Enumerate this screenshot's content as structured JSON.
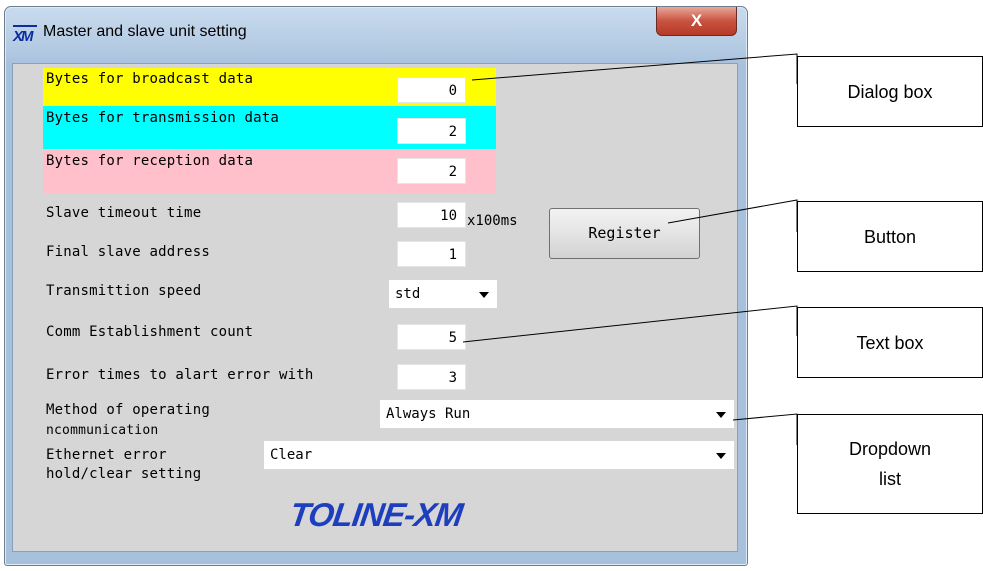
{
  "window": {
    "icon_text": "XM",
    "title": "Master and slave unit setting",
    "close_glyph": "X"
  },
  "fields": {
    "broadcast": {
      "label": "Bytes for broadcast data",
      "value": "0",
      "color": "#ffff00"
    },
    "transmission": {
      "label": "Bytes for transmission data",
      "value": "2",
      "color": "#00ffff"
    },
    "reception": {
      "label": "Bytes for reception data",
      "value": "2",
      "color": "#ffc0cb"
    },
    "slave_timeout": {
      "label": "Slave timeout time",
      "value": "10",
      "unit": "x100ms"
    },
    "final_slave": {
      "label": "Final slave address",
      "value": "1"
    },
    "transmission_speed": {
      "label": "Transmittion speed",
      "value": "std"
    },
    "comm_establish": {
      "label": "Comm Establishment count",
      "value": "5"
    },
    "error_times": {
      "label": "Error times to alart error with",
      "value": "3"
    },
    "method": {
      "label_line1": "Method of operating",
      "label_line2": "ncommunication",
      "value": "Always Run"
    },
    "ethernet_error": {
      "label_line1": "Ethernet error",
      "label_line2": "hold/clear setting",
      "value": "Clear"
    }
  },
  "register_button": {
    "label": "Register"
  },
  "logo": {
    "text": "TOLINE-XM",
    "color": "#1d3fbf"
  },
  "callouts": {
    "dialog_box": "Dialog box",
    "button": "Button",
    "text_box": "Text box",
    "dropdown_line1": "Dropdown",
    "dropdown_line2": "list"
  },
  "icons": [
    "app-logo-icon",
    "close-icon",
    "chevron-down-icon"
  ]
}
